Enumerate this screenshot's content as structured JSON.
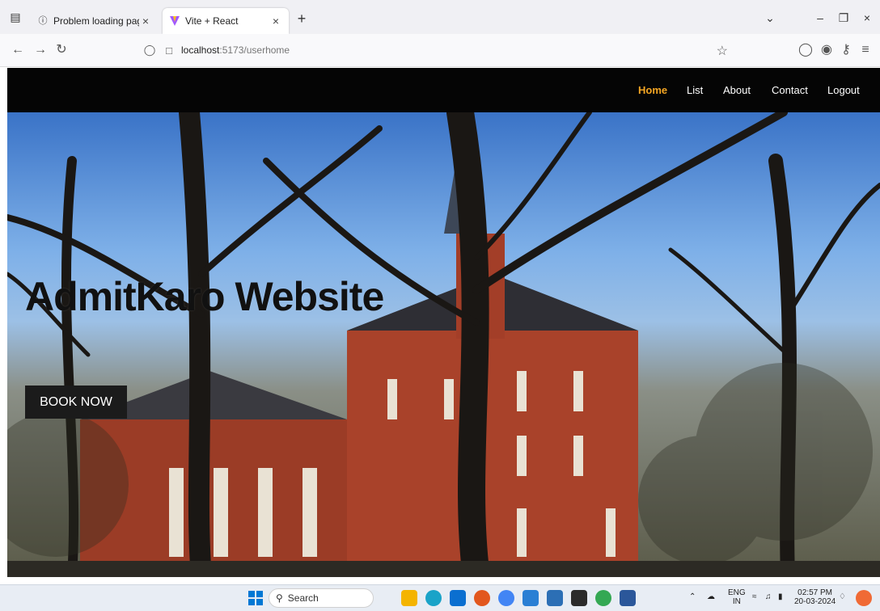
{
  "browser": {
    "tabs": [
      {
        "label": "Problem loading page",
        "icon": "info-icon",
        "active": false
      },
      {
        "label": "Vite + React",
        "icon": "vite-logo-icon",
        "active": true
      }
    ],
    "url_host": "localhost",
    "url_path": ":5173/userhome"
  },
  "app": {
    "nav": [
      {
        "label": "Home",
        "active": true
      },
      {
        "label": "List",
        "active": false
      },
      {
        "label": "About",
        "active": false
      },
      {
        "label": "Contact",
        "active": false
      },
      {
        "label": "Logout",
        "active": false
      }
    ],
    "hero_title": "AdmitKaro Website",
    "book_button": "BOOK NOW",
    "accent_color": "#f5a623"
  },
  "taskbar": {
    "search_label": "Search",
    "lang": "ENG",
    "region": "IN",
    "time": "02:57 PM",
    "date": "20-03-2024"
  }
}
